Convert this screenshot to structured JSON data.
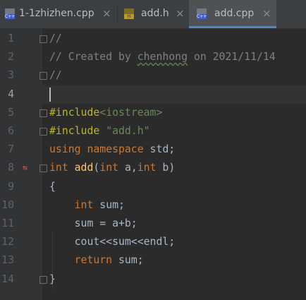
{
  "tabs": [
    {
      "label": "1-1zhizhen.cpp",
      "icon": "cpp-file-icon",
      "badge": "C++"
    },
    {
      "label": "add.h",
      "icon": "header-file-icon",
      "badge": "H"
    },
    {
      "label": "add.cpp",
      "icon": "cpp-file-icon",
      "badge": "C++",
      "active": true
    }
  ],
  "close_glyph": "×",
  "lines": [
    {
      "n": "1",
      "parts": [
        [
          "cmt",
          "//"
        ]
      ]
    },
    {
      "n": "2",
      "parts": [
        [
          "cmt",
          "// Created by "
        ],
        [
          "cmtul",
          "chenhong"
        ],
        [
          "cmt",
          " on 2021/11/14"
        ]
      ]
    },
    {
      "n": "3",
      "parts": [
        [
          "cmt",
          "//"
        ]
      ]
    },
    {
      "n": "4",
      "parts": [],
      "current": true
    },
    {
      "n": "5",
      "parts": [
        [
          "dir",
          "#include"
        ],
        [
          "str",
          "<iostream>"
        ]
      ]
    },
    {
      "n": "6",
      "parts": [
        [
          "dir",
          "#include "
        ],
        [
          "str",
          "\"add.h\""
        ]
      ]
    },
    {
      "n": "7",
      "parts": [
        [
          "kw",
          "using namespace "
        ],
        [
          "plain",
          "std;"
        ]
      ]
    },
    {
      "n": "8",
      "parts": [
        [
          "kw",
          "int "
        ],
        [
          "fn",
          "add"
        ],
        [
          "plain",
          "("
        ],
        [
          "kw",
          "int "
        ],
        [
          "plain",
          "a,"
        ],
        [
          "kw",
          "int "
        ],
        [
          "plain",
          "b)"
        ]
      ]
    },
    {
      "n": "9",
      "parts": [
        [
          "plain",
          "{"
        ]
      ]
    },
    {
      "n": "10",
      "parts": [
        [
          "plain",
          "    "
        ],
        [
          "kw",
          "int "
        ],
        [
          "plain",
          "sum;"
        ]
      ]
    },
    {
      "n": "11",
      "parts": [
        [
          "plain",
          "    sum = a+b;"
        ]
      ]
    },
    {
      "n": "12",
      "parts": [
        [
          "plain",
          "    cout<<sum<<endl;"
        ]
      ]
    },
    {
      "n": "13",
      "parts": [
        [
          "plain",
          "    "
        ],
        [
          "kw",
          "return "
        ],
        [
          "plain",
          "sum;"
        ]
      ]
    },
    {
      "n": "14",
      "parts": [
        [
          "plain",
          "}"
        ]
      ]
    }
  ],
  "gutter_markers": {
    "line": "8",
    "icon": "implementation-arrows-icon",
    "glyph_left": "⇆"
  },
  "fold_lines": [
    "1",
    "3",
    "5",
    "6",
    "8",
    "14"
  ],
  "colors": {
    "background": "#2b2b2b",
    "tab_active_underline": "#4a88c7",
    "comment": "#808080",
    "directive": "#bbb529",
    "string": "#6a8759",
    "keyword": "#cc7832",
    "function": "#ffc66d",
    "text": "#a9b7c6"
  }
}
